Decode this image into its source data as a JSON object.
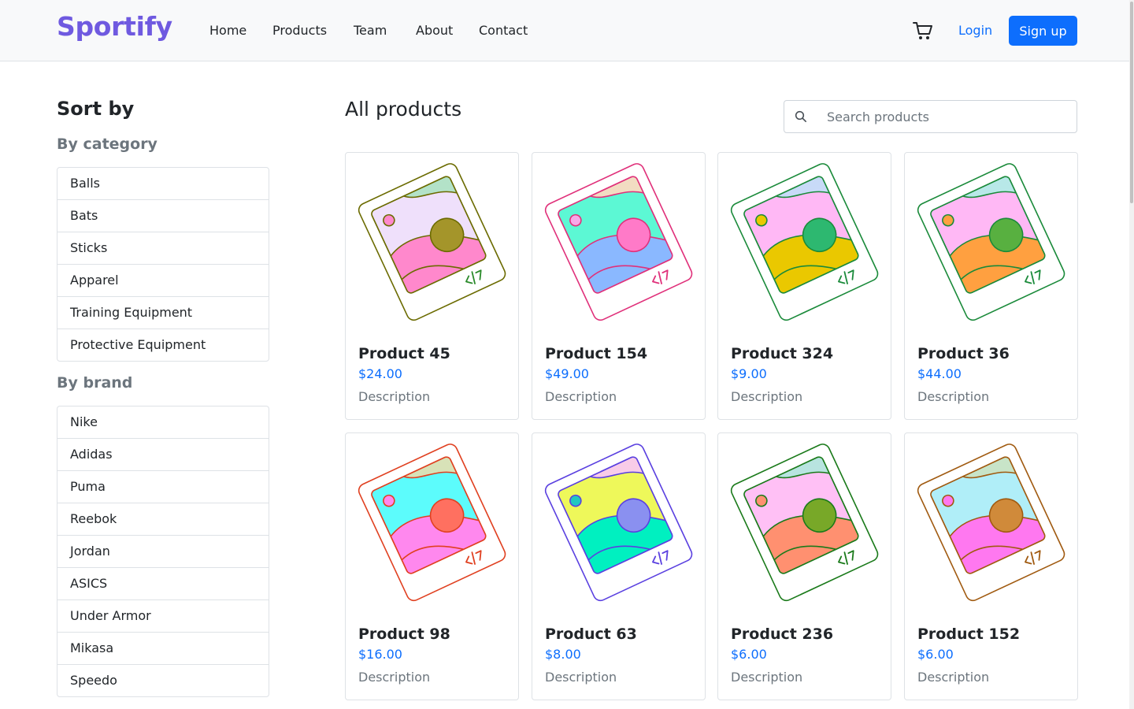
{
  "header": {
    "brand": "Sportify",
    "nav": [
      "Home",
      "Products",
      "Team",
      "About",
      "Contact"
    ],
    "login": "Login",
    "signup": "Sign up"
  },
  "sidebar": {
    "title": "Sort by",
    "category_title": "By category",
    "categories": [
      "Balls",
      "Bats",
      "Sticks",
      "Apparel",
      "Training Equipment",
      "Protective Equipment"
    ],
    "brand_title": "By brand",
    "brands": [
      "Nike",
      "Adidas",
      "Puma",
      "Reebok",
      "Jordan",
      "ASICS",
      "Under Armor",
      "Mikasa",
      "Speedo"
    ]
  },
  "main": {
    "title": "All products",
    "search_placeholder": "Search products",
    "products": [
      {
        "name": "Product 45",
        "price": "$24.00",
        "description": "Description",
        "colors": {
          "frame": "#6b6b00",
          "bg": "#efe0fb",
          "top": "#b3e2c8",
          "hill": "#ff88cc",
          "sun": "#a4952a",
          "dot": "#ff88cc",
          "code": "#2a8a2a"
        }
      },
      {
        "name": "Product 154",
        "price": "$49.00",
        "description": "Description",
        "colors": {
          "frame": "#e0307a",
          "bg": "#5cf8d4",
          "top": "#f2dcc2",
          "hill": "#8ab8ff",
          "sun": "#ff7ac8",
          "dot": "#f8a8e8",
          "code": "#e0307a"
        }
      },
      {
        "name": "Product 324",
        "price": "$9.00",
        "description": "Description",
        "colors": {
          "frame": "#1a8a3a",
          "bg": "#ffb8f5",
          "top": "#c8daf8",
          "hill": "#eac800",
          "sun": "#2db870",
          "dot": "#eac800",
          "code": "#1a8a3a"
        }
      },
      {
        "name": "Product 36",
        "price": "$44.00",
        "description": "Description",
        "colors": {
          "frame": "#1a8a3a",
          "bg": "#ffb8f5",
          "top": "#b8e8e8",
          "hill": "#ffa040",
          "sun": "#58b040",
          "dot": "#ffa040",
          "code": "#1a8a3a"
        }
      },
      {
        "name": "Product 98",
        "price": "$16.00",
        "description": "Description",
        "colors": {
          "frame": "#e04020",
          "bg": "#5cfcfc",
          "top": "#d8e2b8",
          "hill": "#ff88ee",
          "sun": "#ff7060",
          "dot": "#ff88ee",
          "code": "#e04020"
        }
      },
      {
        "name": "Product 63",
        "price": "$8.00",
        "description": "Description",
        "colors": {
          "frame": "#5a40e0",
          "bg": "#eef85a",
          "top": "#f8cce8",
          "hill": "#00f0c0",
          "sun": "#8a90f0",
          "dot": "#20c8c0",
          "code": "#5a40e0"
        }
      },
      {
        "name": "Product 236",
        "price": "$6.00",
        "description": "Description",
        "colors": {
          "frame": "#1a7a1a",
          "bg": "#ffc0f5",
          "top": "#b8e4e0",
          "hill": "#ff9070",
          "sun": "#78a828",
          "dot": "#ff9070",
          "code": "#1a7a1a"
        }
      },
      {
        "name": "Product 152",
        "price": "$6.00",
        "description": "Description",
        "colors": {
          "frame": "#a05a10",
          "bg": "#b0eef8",
          "top": "#c8e4c8",
          "hill": "#ff78f0",
          "sun": "#d08a3a",
          "dot": "#ff78f0",
          "code": "#a05a10"
        }
      }
    ]
  },
  "colors": {
    "brand": "#6f5ae0",
    "primary": "#0d6efd",
    "muted": "#6c757d"
  }
}
